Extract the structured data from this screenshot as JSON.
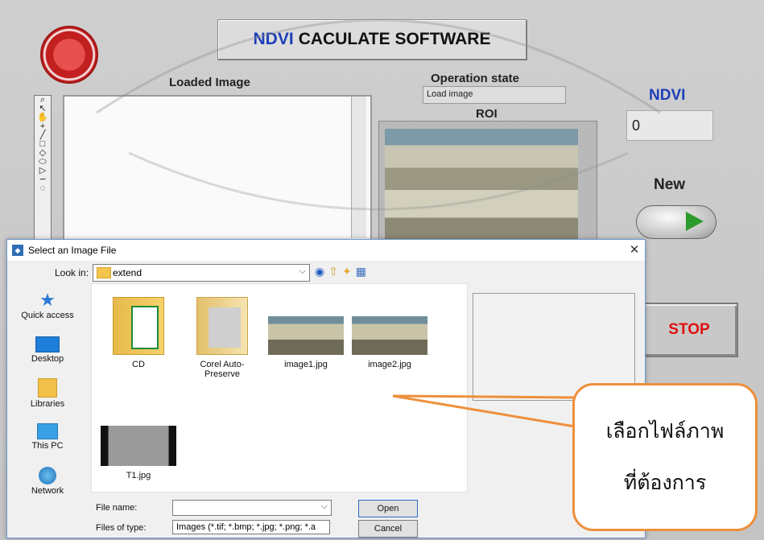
{
  "app": {
    "title_accent": "NDVI",
    "title_rest": "CACULATE SOFTWARE",
    "loaded_image_label": "Loaded Image",
    "operation_state_label": "Operation state",
    "operation_state_value": "Load image",
    "roi_label": "ROI",
    "ndvi_label": "NDVI",
    "ndvi_value": "0",
    "new_label": "New",
    "stop_label": "STOP"
  },
  "dialog": {
    "title": "Select an Image File",
    "look_in_label": "Look in:",
    "look_in_value": "extend",
    "places": [
      "Quick access",
      "Desktop",
      "Libraries",
      "This PC",
      "Network"
    ],
    "files": [
      {
        "name": "CD",
        "kind": "folder-icon"
      },
      {
        "name": "Corel Auto-Preserve",
        "kind": "folder-icon"
      },
      {
        "name": "image1.jpg",
        "kind": "image-thumbnail"
      },
      {
        "name": "image2.jpg",
        "kind": "image-thumbnail"
      },
      {
        "name": "T1.jpg",
        "kind": "image-thumbnail"
      }
    ],
    "file_name_label": "File name:",
    "file_name_value": "",
    "file_type_label": "Files of type:",
    "file_type_value": "Images (*.tif; *.bmp; *.jpg; *.png; *.a",
    "open_label": "Open",
    "cancel_label": "Cancel"
  },
  "callout": {
    "line1": "เลือกไฟล์ภาพ",
    "line2": "ที่ต้องการ"
  },
  "colors": {
    "accent_blue": "#1e3fb8",
    "stop_red": "#e01010",
    "callout_orange": "#ee8f3b",
    "run_green": "#2d9a2d"
  }
}
